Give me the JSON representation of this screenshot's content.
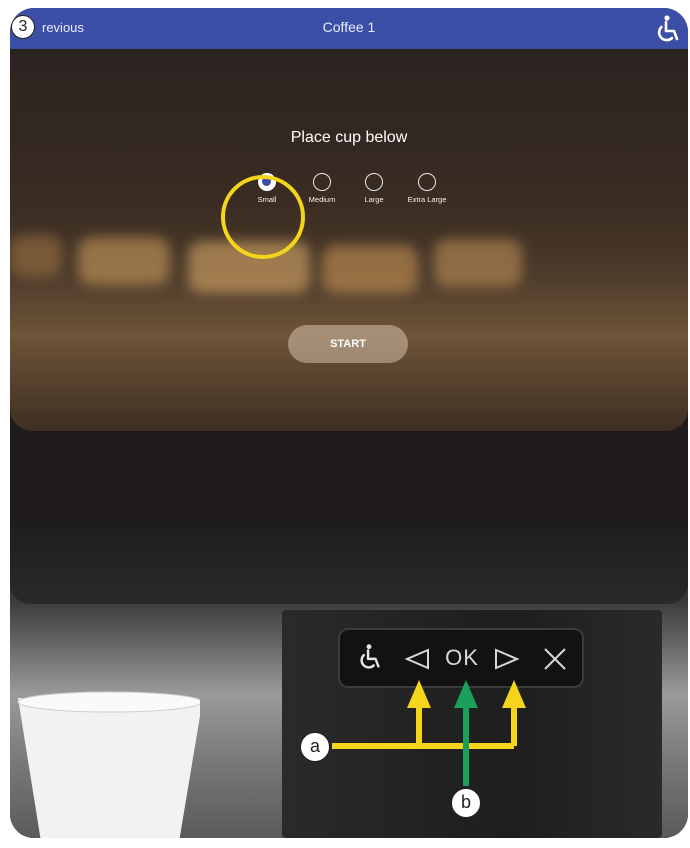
{
  "header": {
    "previous_label": "revious",
    "title": "Coffee 1",
    "accessibility_icon": "wheelchair-icon"
  },
  "step_badge": "3",
  "main": {
    "heading": "Place cup below",
    "sizes": [
      {
        "label": "Small",
        "selected": true
      },
      {
        "label": "Medium",
        "selected": false
      },
      {
        "label": "Large",
        "selected": false
      },
      {
        "label": "Extra Large",
        "selected": false
      }
    ],
    "start_label": "START"
  },
  "physical_buttons": {
    "ok_label": "OK",
    "icons": [
      "wheelchair-icon",
      "left-arrow-icon",
      "ok-button",
      "right-arrow-icon",
      "close-icon"
    ]
  },
  "callouts": {
    "a": "a",
    "b": "b"
  },
  "colors": {
    "header_bg": "#3b4fa6",
    "highlight": "#f4d51b",
    "arrow_yellow": "#f4d51b",
    "arrow_green": "#1aa05a"
  }
}
